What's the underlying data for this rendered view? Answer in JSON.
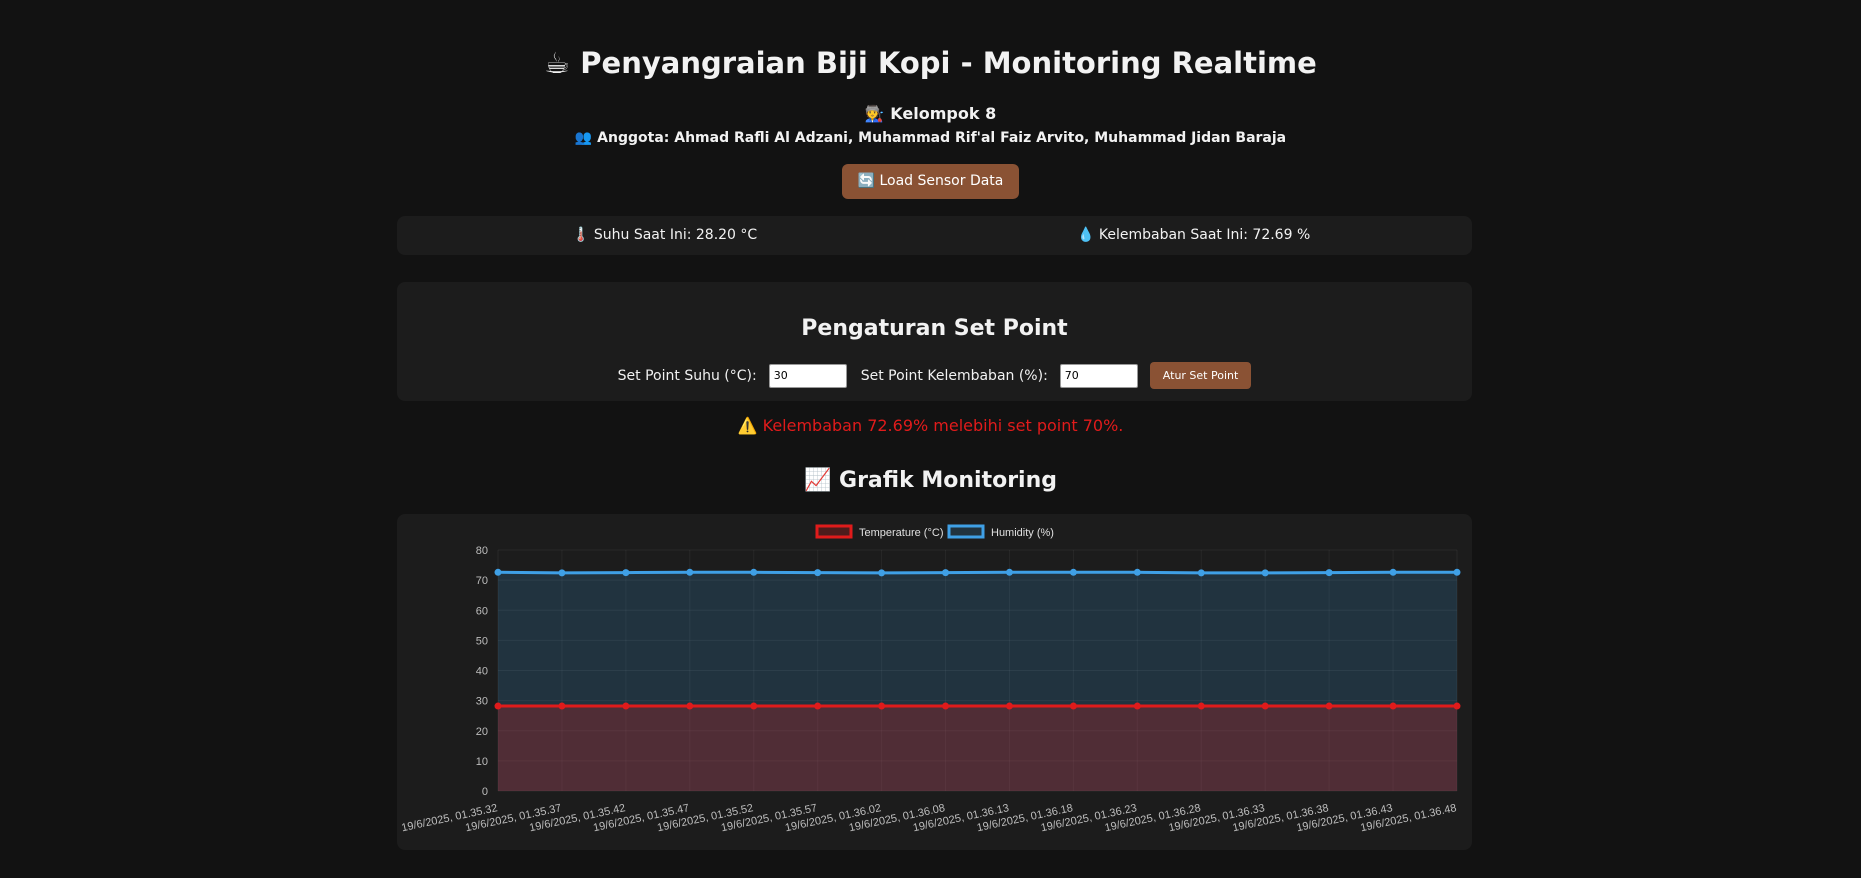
{
  "header": {
    "title": "☕ Penyangraian Biji Kopi - Monitoring Realtime",
    "group": "🧑‍🏭 Kelompok 8",
    "members": "👥 Anggota: Ahmad Rafli Al Adzani, Muhammad Rif'al Faiz Arvito, Muhammad Jidan Baraja",
    "load_button": "🔄 Load Sensor Data"
  },
  "readings": {
    "temperature": "🌡️ Suhu Saat Ini: 28.20 °C",
    "humidity": "💧 Kelembaban Saat Ini: 72.69 %"
  },
  "setpoint": {
    "title": "Pengaturan Set Point",
    "temp_label": "Set Point Suhu (°C):",
    "temp_value": "30",
    "hum_label": "Set Point Kelembaban (%):",
    "hum_value": "70",
    "button": "Atur Set Point"
  },
  "warning": "⚠️ Kelembaban 72.69% melebihi set point 70%.",
  "chart_section": {
    "title": "📈 Grafik Monitoring"
  },
  "colors": {
    "temperature": "#e01b1b",
    "humidity": "#3fa0e6",
    "accent": "#8a5234"
  },
  "chart_data": {
    "type": "line",
    "x": [
      "19/6/2025, 01.35.32",
      "19/6/2025, 01.35.37",
      "19/6/2025, 01.35.42",
      "19/6/2025, 01.35.47",
      "19/6/2025, 01.35.52",
      "19/6/2025, 01.35.57",
      "19/6/2025, 01.36.02",
      "19/6/2025, 01.36.08",
      "19/6/2025, 01.36.13",
      "19/6/2025, 01.36.18",
      "19/6/2025, 01.36.23",
      "19/6/2025, 01.36.28",
      "19/6/2025, 01.36.33",
      "19/6/2025, 01.36.38",
      "19/6/2025, 01.36.43",
      "19/6/2025, 01.36.48"
    ],
    "series": [
      {
        "name": "Temperature (°C)",
        "values": [
          28.2,
          28.2,
          28.2,
          28.2,
          28.2,
          28.2,
          28.2,
          28.2,
          28.2,
          28.2,
          28.2,
          28.2,
          28.2,
          28.2,
          28.2,
          28.2
        ]
      },
      {
        "name": "Humidity (%)",
        "values": [
          72.6,
          72.4,
          72.5,
          72.6,
          72.6,
          72.5,
          72.4,
          72.5,
          72.6,
          72.6,
          72.6,
          72.4,
          72.4,
          72.5,
          72.6,
          72.6
        ]
      }
    ],
    "yticks": [
      0,
      10,
      20,
      30,
      40,
      50,
      60,
      70,
      80
    ],
    "ylim": [
      0,
      80
    ],
    "fill": true,
    "grid": true,
    "legend": "top-center"
  }
}
